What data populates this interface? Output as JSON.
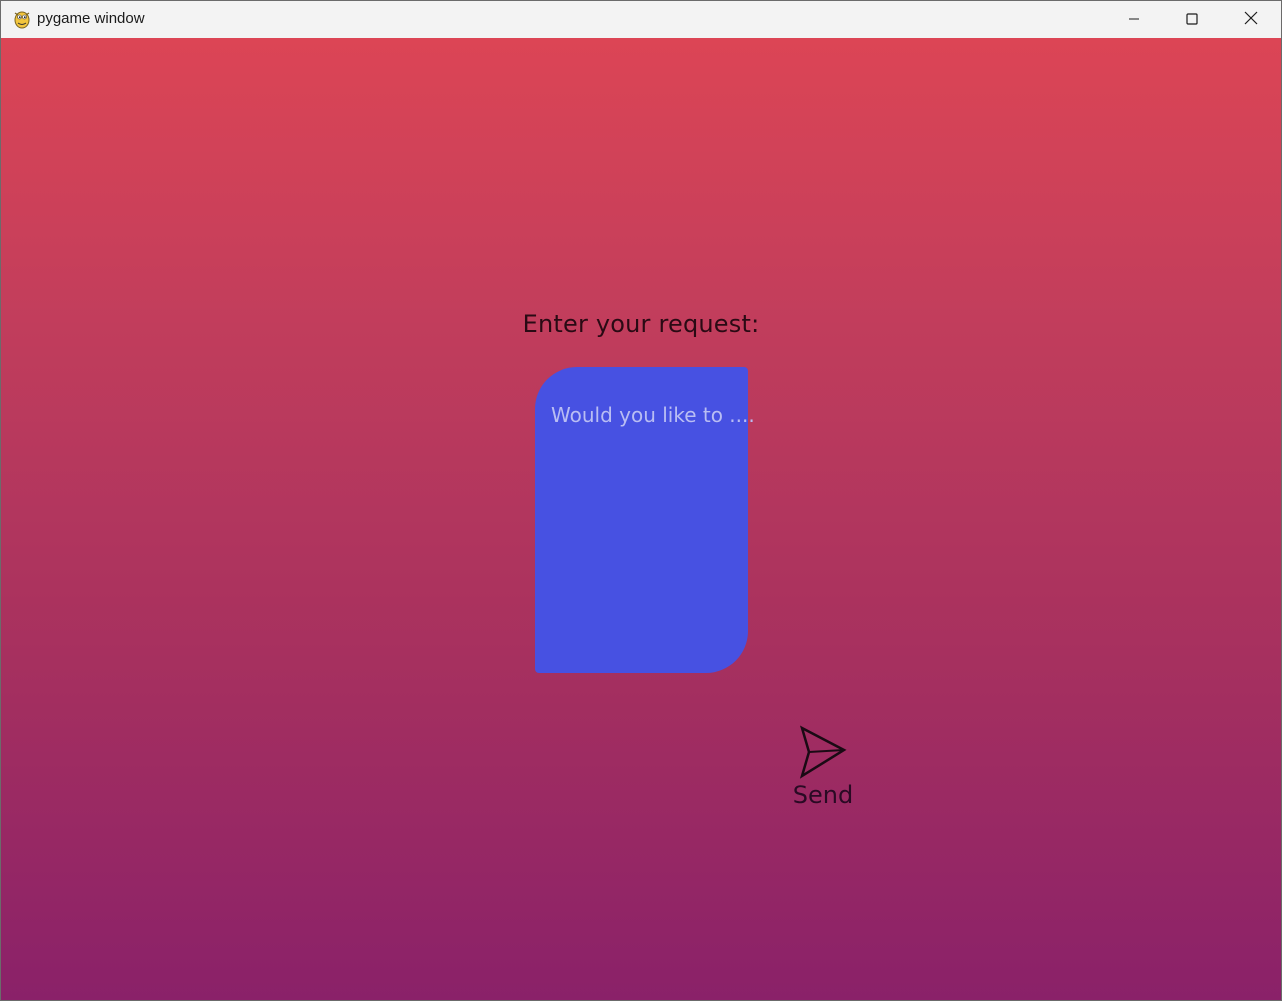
{
  "window": {
    "title": "pygame window",
    "app_icon": "pygame-snake-icon",
    "controls": {
      "minimize_icon": "minimize-icon",
      "maximize_icon": "maximize-icon",
      "close_icon": "close-icon"
    }
  },
  "main": {
    "prompt_label": "Enter your request:",
    "request_input": {
      "value": "Would you like to ...."
    },
    "send_button": {
      "label": "Send",
      "icon": "paper-plane-icon"
    }
  },
  "colors": {
    "gradient_top": "#dc4555",
    "gradient_bottom": "#8a2169",
    "input_box": "#4751e2",
    "input_text": "#b9bdf3",
    "label_text": "#2a0a14"
  }
}
